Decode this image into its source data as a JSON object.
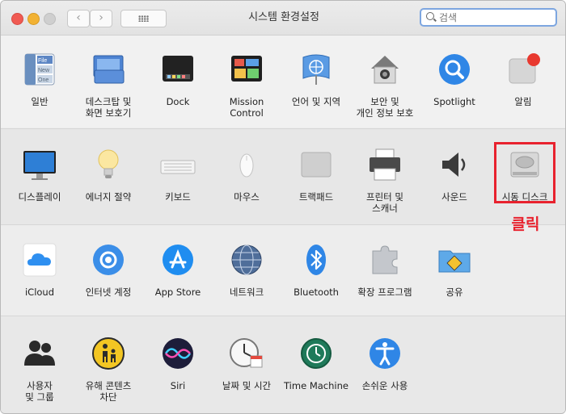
{
  "window": {
    "title": "시스템 환경설정"
  },
  "toolbar": {
    "back": "‹",
    "forward": "›"
  },
  "search": {
    "placeholder": "검색"
  },
  "rows": [
    [
      "일반",
      "데스크탑 및\n화면 보호기",
      "Dock",
      "Mission\nControl",
      "언어 및 지역",
      "보안 및\n개인 정보 보호",
      "Spotlight",
      "알림"
    ],
    [
      "디스플레이",
      "에너지 절약",
      "키보드",
      "마우스",
      "트랙패드",
      "프린터 및\n스캐너",
      "사운드",
      "시동 디스크"
    ],
    [
      "iCloud",
      "인터넷 계정",
      "App Store",
      "네트워크",
      "Bluetooth",
      "확장 프로그램",
      "공유"
    ],
    [
      "사용자\n및 그룹",
      "유해 콘텐츠\n차단",
      "Siri",
      "날짜 및 시간",
      "Time Machine",
      "손쉬운 사용"
    ]
  ],
  "general_icon_text": [
    "File",
    "New",
    "One"
  ],
  "annotation": {
    "text": "클릭"
  }
}
